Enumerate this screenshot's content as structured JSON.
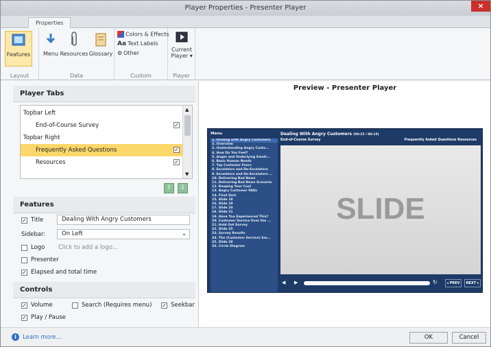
{
  "window": {
    "title": "Player Properties - Presenter Player",
    "close": "×"
  },
  "ribbon": {
    "tab": "Properties",
    "groups": {
      "layout": {
        "label": "Layout",
        "features": "Features"
      },
      "data": {
        "label": "Data",
        "menu": "Menu",
        "resources": "Resources",
        "glossary": "Glossary"
      },
      "custom": {
        "label": "Custom",
        "colors": "Colors & Effects",
        "text_labels": "Text Labels",
        "other": "Other"
      },
      "player": {
        "label": "Player",
        "current_player_1": "Current",
        "current_player_2": "Player ▾"
      }
    }
  },
  "player_tabs": {
    "header": "Player Tabs",
    "rows": [
      {
        "label": "Topbar Left",
        "type": "group"
      },
      {
        "label": "End-of-Course Survey",
        "type": "item",
        "checked": true
      },
      {
        "label": "Topbar Right",
        "type": "group"
      },
      {
        "label": "Frequently Asked Questions",
        "type": "item",
        "checked": true,
        "selected": true
      },
      {
        "label": "Resources",
        "type": "item",
        "checked": true
      }
    ]
  },
  "features": {
    "header": "Features",
    "title_label": "Title",
    "title_value": "Dealing With Angry Customers",
    "sidebar_label": "Sidebar:",
    "sidebar_value": "On Left",
    "logo_label": "Logo",
    "logo_hint": "Click to add a logo...",
    "presenter_label": "Presenter",
    "elapsed_label": "Elapsed and total time"
  },
  "controls": {
    "header": "Controls",
    "volume": "Volume",
    "search": "Search (Requires menu)",
    "seekbar": "Seekbar",
    "play_pause": "Play / Pause"
  },
  "preview": {
    "title": "Preview - Presenter Player",
    "menu_header": "Menu",
    "course_title": "Dealing With Angry Customers",
    "time": "(00:15 / 00:15)",
    "survey": "End-of-Course Survey",
    "tabs": "Frequently Asked Questions    Resources",
    "slide_text": "SLIDE",
    "prev": "◂ PREV",
    "next": "NEXT ▸",
    "menu_items": [
      "1. Dealing with Angry Customers",
      "2. Overview",
      "3. Understanding Angry Custo...",
      "4. How Do You Feel?",
      "5. Anger and Underlying Emoti...",
      "6. Basic Human Needs",
      "7. Top Customer Fears",
      "8. Escalators and De-Escalators",
      "9. Escalators and De-Escalators ...",
      "10. Delivering Bad News",
      "11. Delivering Bad News Scenario",
      "12. Keeping Your Cool",
      "13. Angry Customer FAQs",
      "14. Final Quiz",
      "15. Slide 18",
      "16. Slide 19",
      "17. Slide 20",
      "18. Slide 21",
      "19. Have You Experienced This?",
      "20. Customer Service Over the ...",
      "21. Hold Out Survey",
      "22. Slide 25",
      "23. Survey Results",
      "24. The (Customer Service) Ess...",
      "25. Slide 28",
      "26. Circle Diagram"
    ]
  },
  "footer": {
    "learn_more": "Learn more...",
    "ok": "OK",
    "cancel": "Cancel"
  }
}
